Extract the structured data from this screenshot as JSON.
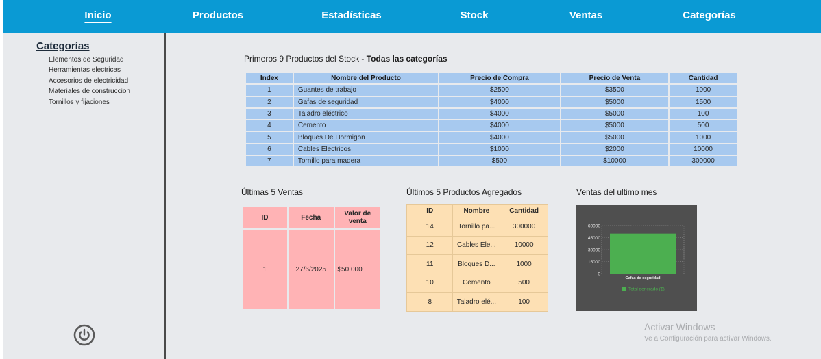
{
  "nav": {
    "items": [
      "Inicio",
      "Productos",
      "Estadísticas",
      "Stock",
      "Ventas",
      "Categorías"
    ]
  },
  "sidebar": {
    "title": "Categorías",
    "items": [
      "Elementos de Seguridad",
      "Herramientas electricas",
      "Accesorios de electricidad",
      "Materiales de construccion",
      "Tornillos y fijaciones"
    ]
  },
  "stock": {
    "title": "Primeros 9 Productos del Stock - ",
    "title_bold": "Todas las categorías",
    "columns": [
      "Index",
      "Nombre del Producto",
      "Precio de Compra",
      "Precio de Venta",
      "Cantidad"
    ],
    "rows": [
      [
        "1",
        "Guantes de trabajo",
        "$2500",
        "$3500",
        "1000"
      ],
      [
        "2",
        "Gafas de seguridad",
        "$4000",
        "$5000",
        "1500"
      ],
      [
        "3",
        "Taladro eléctrico",
        "$4000",
        "$5000",
        "100"
      ],
      [
        "4",
        "Cemento",
        "$4000",
        "$5000",
        "500"
      ],
      [
        "5",
        "Bloques De Hormigon",
        "$4000",
        "$5000",
        "1000"
      ],
      [
        "6",
        "Cables Electricos",
        "$1000",
        "$2000",
        "10000"
      ],
      [
        "7",
        "Tornillo para madera",
        "$500",
        "$10000",
        "300000"
      ]
    ]
  },
  "sales": {
    "title": "Últimas 5 Ventas",
    "columns": [
      "ID",
      "Fecha",
      "Valor de venta"
    ],
    "rows": [
      [
        "1",
        "27/6/2025",
        "$50.000"
      ]
    ]
  },
  "added": {
    "title": "Últimos 5 Productos Agregados",
    "columns": [
      "ID",
      "Nombre",
      "Cantidad"
    ],
    "rows": [
      [
        "14",
        "Tornillo pa...",
        "300000"
      ],
      [
        "12",
        "Cables Ele...",
        "10000"
      ],
      [
        "11",
        "Bloques D...",
        "1000"
      ],
      [
        "10",
        "Cemento",
        "500"
      ],
      [
        "8",
        "Taladro elé...",
        "100"
      ]
    ]
  },
  "monthly": {
    "title": "Ventas del ultimo mes"
  },
  "chart_data": {
    "type": "bar",
    "categories": [
      "Gafas de seguridad"
    ],
    "series": [
      {
        "name": "Total generado ($)",
        "values": [
          50000
        ],
        "color": "#4caf50"
      }
    ],
    "yticks": [
      "60000",
      "45000",
      "30000",
      "15000",
      "0"
    ],
    "ylim": [
      0,
      60000
    ],
    "background": "#4f4f4f",
    "grid": true,
    "legend": "bottom"
  },
  "watermark": {
    "line1": "Activar Windows",
    "line2": "Ve a Configuración para activar Windows."
  }
}
